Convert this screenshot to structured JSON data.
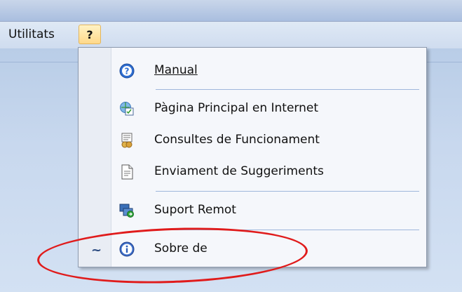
{
  "menubar": {
    "utilitats_label": "Utilitats",
    "help_label": "?"
  },
  "menu": {
    "items": [
      {
        "label": "Manual",
        "icon": "help-circle-icon"
      },
      {
        "label": "Pàgina Principal en Internet",
        "icon": "web-page-icon"
      },
      {
        "label": "Consultes de Funcionament",
        "icon": "faq-icon"
      },
      {
        "label": "Enviament de Suggeriments",
        "icon": "suggestion-document-icon"
      },
      {
        "label": "Suport Remot",
        "icon": "remote-support-icon"
      },
      {
        "label": "Sobre de",
        "icon": "info-icon"
      }
    ]
  },
  "colors": {
    "highlight_ellipse": "#e01b1b",
    "help_button": "#ffd98a",
    "separator": "#9fb7db"
  }
}
